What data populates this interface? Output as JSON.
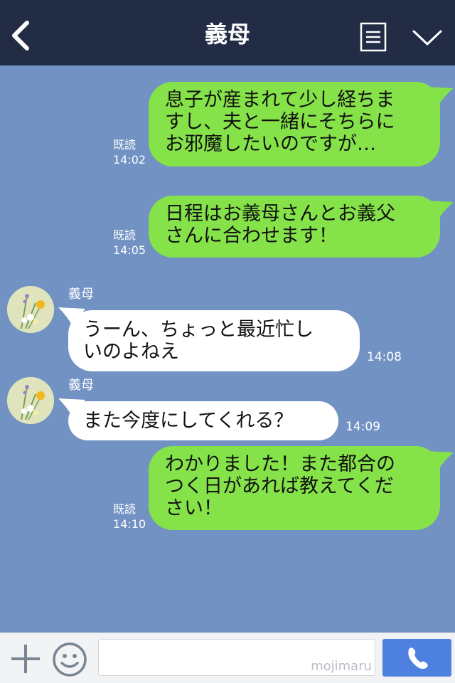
{
  "header": {
    "title": "義母",
    "back_icon": "chevron-left-icon",
    "menu_icon": "document-list-icon",
    "collapse_icon": "chevron-down-icon"
  },
  "messages": [
    {
      "direction": "sent",
      "text": "息子が産まれて少し経ちま\nすし、夫と一緒にそちらに\nお邪魔したいのですが…",
      "read_label": "既読",
      "time": "14:02"
    },
    {
      "direction": "sent",
      "text": "日程はお義母さんとお義父\nさんに合わせます！",
      "read_label": "既読",
      "time": "14:05"
    },
    {
      "direction": "received",
      "sender": "義母",
      "text": "うーん、ちょっと最近忙し\nいのよねえ",
      "time": "14:08"
    },
    {
      "direction": "received",
      "sender": "義母",
      "text": "また今度にしてくれる？",
      "time": "14:09"
    },
    {
      "direction": "sent",
      "text": "わかりました！また都合の\nつく日があれば教えてくだ\nさい！",
      "read_label": "既読",
      "time": "14:10"
    }
  ],
  "input_bar": {
    "text_value": "",
    "watermark": "mojimaru",
    "plus_icon": "plus-icon",
    "emoji_icon": "smiley-icon",
    "call_icon": "phone-icon"
  },
  "colors": {
    "header_bg": "#222c44",
    "chat_bg": "#7192c2",
    "sent_bubble": "#85e249",
    "received_bubble": "#ffffff",
    "call_button": "#4e80e0"
  }
}
